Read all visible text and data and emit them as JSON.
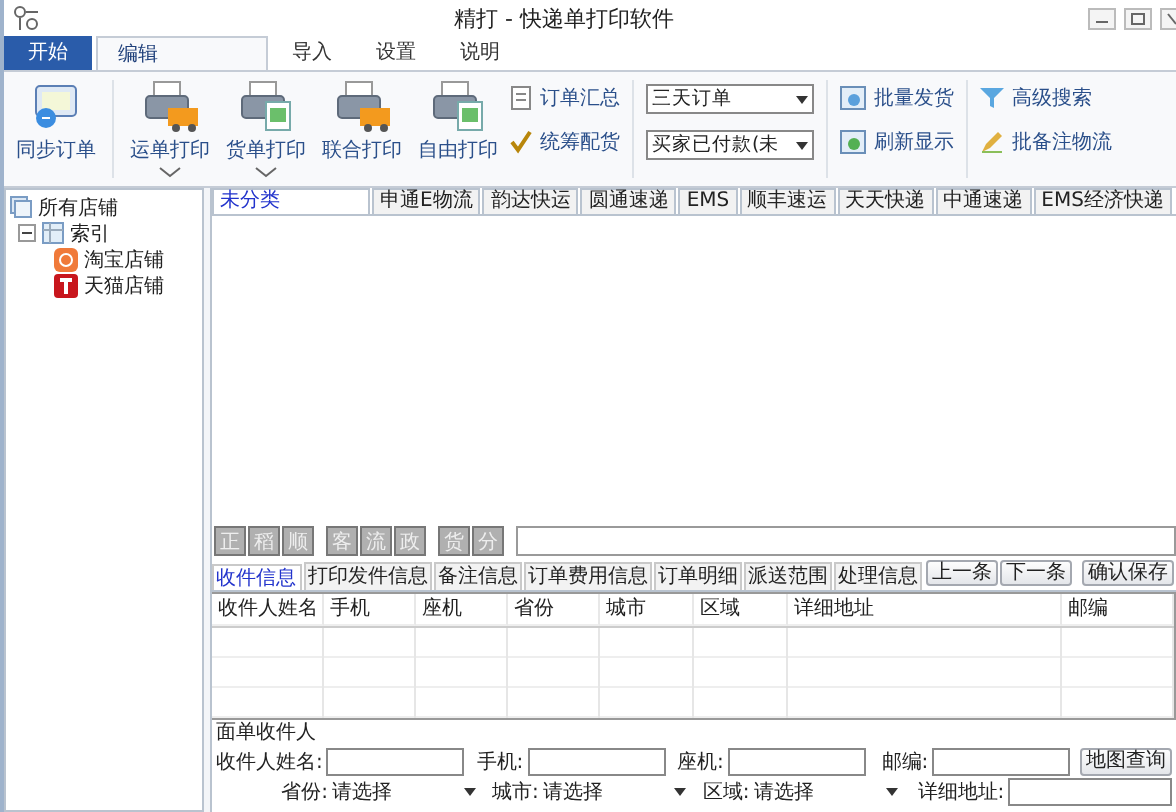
{
  "window": {
    "title": "精打 - 快递单打印软件"
  },
  "ribbon_tabs": [
    {
      "label": "开始",
      "kind": "app",
      "selected": false
    },
    {
      "label": "编辑",
      "kind": "tab",
      "selected": true
    },
    {
      "label": "导入",
      "kind": "tab",
      "selected": false
    },
    {
      "label": "设置",
      "kind": "tab",
      "selected": false
    },
    {
      "label": "说明",
      "kind": "tab",
      "selected": false
    }
  ],
  "ribbon": {
    "sync_button": {
      "label": "同步订单"
    },
    "print_buttons": [
      {
        "label": "运单打印",
        "has_dropdown": true
      },
      {
        "label": "货单打印",
        "has_dropdown": true
      },
      {
        "label": "联合打印",
        "has_dropdown": false
      },
      {
        "label": "自由打印",
        "has_dropdown": false
      }
    ],
    "order_links": [
      "订单汇总",
      "统筹配货"
    ],
    "dropdowns": [
      {
        "value": "三天订单"
      },
      {
        "value": "买家已付款(未"
      }
    ],
    "ship_links": [
      "批量发货",
      "刷新显示"
    ],
    "search_links": [
      "高级搜索",
      "批备注物流"
    ]
  },
  "sidebar": {
    "tree": [
      {
        "label": "所有店铺",
        "children": [
          {
            "label": "索引",
            "expanded": true,
            "children": [
              {
                "label": "淘宝店铺"
              },
              {
                "label": "天猫店铺"
              }
            ]
          }
        ]
      }
    ]
  },
  "courier_tabs": [
    {
      "label": "未分类",
      "selected": true
    },
    {
      "label": "申通E物流",
      "selected": false
    },
    {
      "label": "韵达快运",
      "selected": false
    },
    {
      "label": "圆通速递",
      "selected": false
    },
    {
      "label": "EMS",
      "selected": false
    },
    {
      "label": "顺丰速运",
      "selected": false
    },
    {
      "label": "天天快递",
      "selected": false
    },
    {
      "label": "中通速递",
      "selected": false
    },
    {
      "label": "EMS经济快递",
      "selected": false
    }
  ],
  "action_groups": [
    {
      "chars": [
        "正",
        "稻",
        "顺"
      ],
      "disabled": true
    },
    {
      "chars": [
        "客",
        "流",
        "政"
      ],
      "disabled": true
    },
    {
      "chars": [
        "货",
        "分"
      ],
      "disabled": true
    }
  ],
  "detail_tabs": [
    {
      "label": "收件信息",
      "selected": true
    },
    {
      "label": "打印发件信息",
      "selected": false
    },
    {
      "label": "备注信息",
      "selected": false
    },
    {
      "label": "订单费用信息",
      "selected": false
    },
    {
      "label": "订单明细",
      "selected": false
    },
    {
      "label": "派送范围",
      "selected": false
    },
    {
      "label": "处理信息",
      "selected": false
    }
  ],
  "nav_buttons": [
    "上一条",
    "下一条"
  ],
  "save_button": "确认保存",
  "table": {
    "columns": [
      "收件人姓名",
      "手机",
      "座机",
      "省份",
      "城市",
      "区域",
      "详细地址",
      "邮编"
    ]
  },
  "form": {
    "title": "面单收件人",
    "text_fields": [
      {
        "label": "收件人姓名:"
      },
      {
        "label": "手机:"
      },
      {
        "label": "座机:"
      },
      {
        "label": "邮编:"
      }
    ],
    "map_button": "地图查询",
    "selects": [
      {
        "label": "省份:",
        "value": "请选择"
      },
      {
        "label": "城市:",
        "value": "请选择"
      },
      {
        "label": "区域:",
        "value": "请选择"
      }
    ],
    "address_field": {
      "label": "详细地址:"
    }
  }
}
